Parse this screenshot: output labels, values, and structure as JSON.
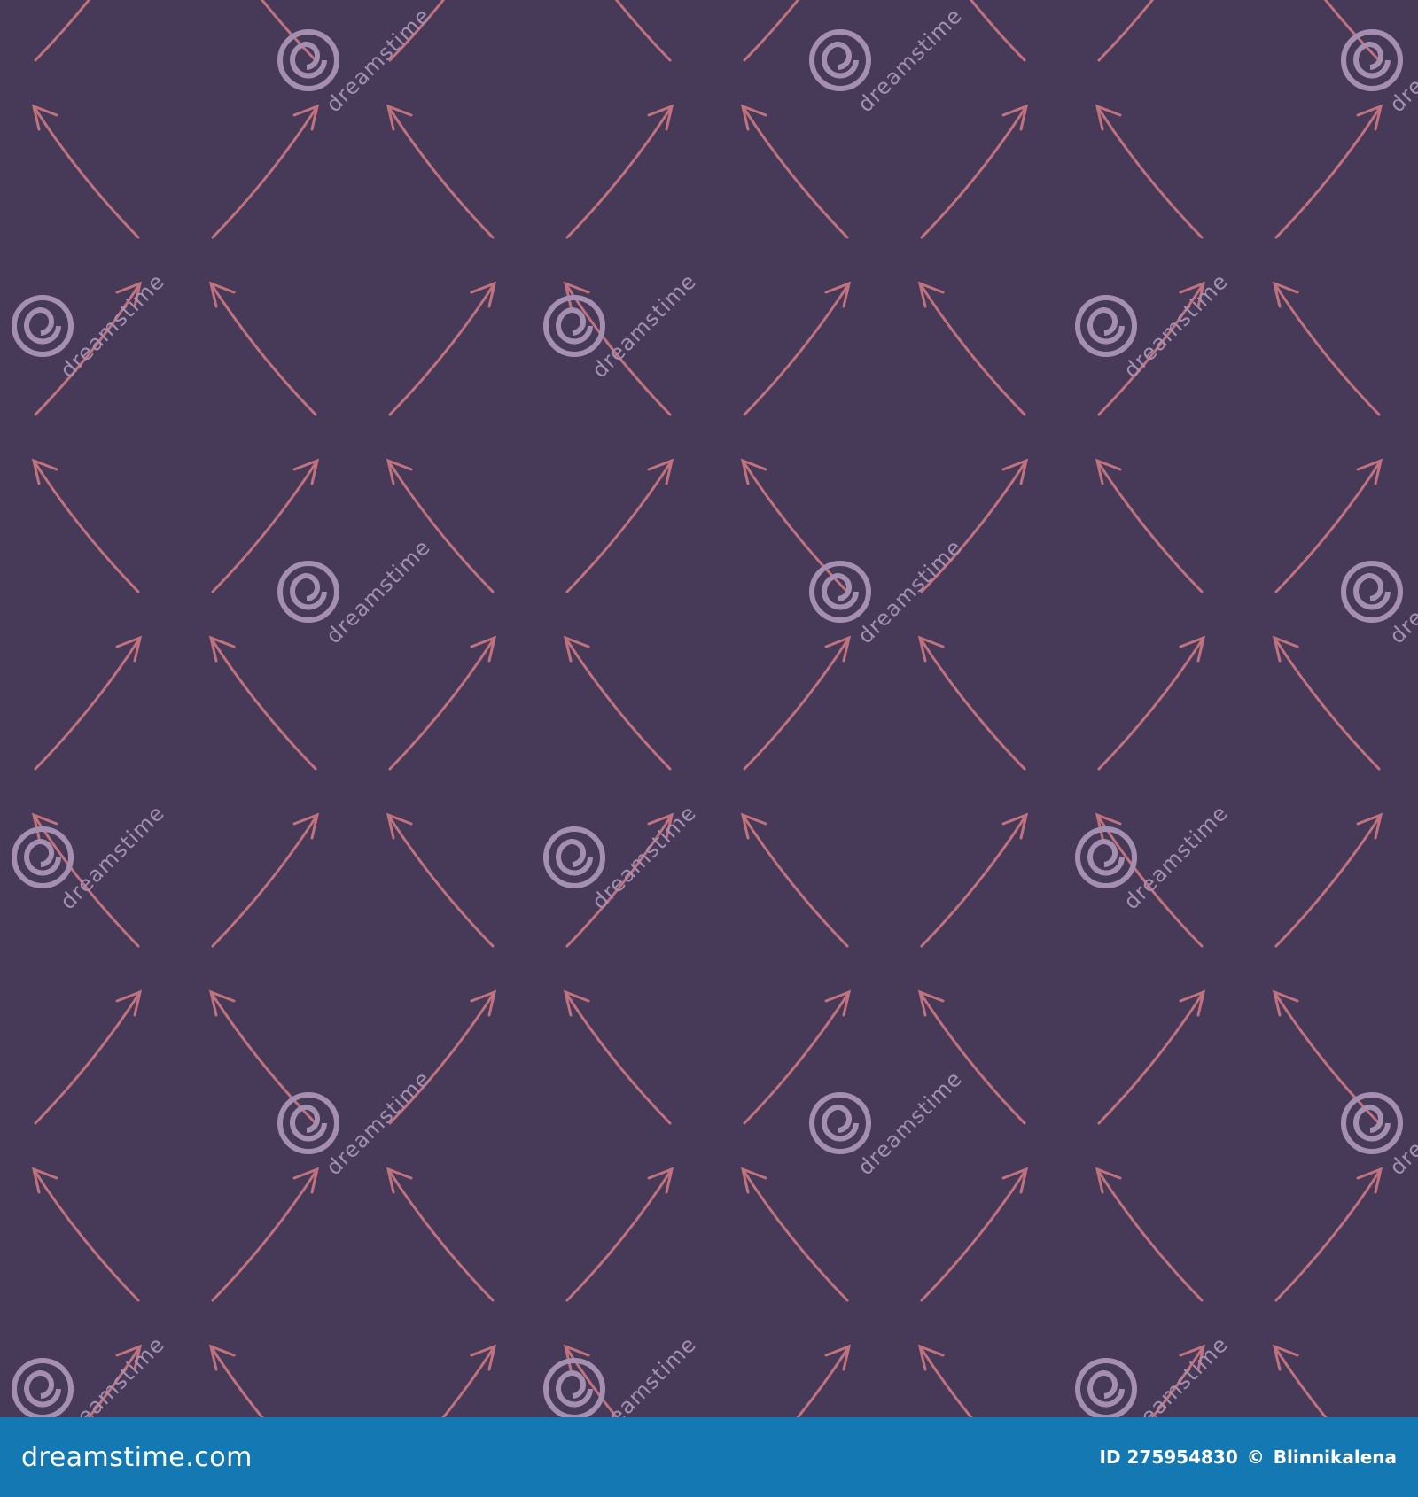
{
  "colors": {
    "background": "#473a58",
    "arrow": "#c0727f",
    "watermark": "#a58fb0",
    "footer": "#1479b3",
    "footer_text": "#ffffff"
  },
  "watermark": {
    "text": "dreamstime",
    "icon": "spiral-logo-icon"
  },
  "footer": {
    "brand": "dreamstime.com",
    "id_label": "ID 275954830",
    "copyright": "©",
    "author": "Blinnikalena"
  }
}
